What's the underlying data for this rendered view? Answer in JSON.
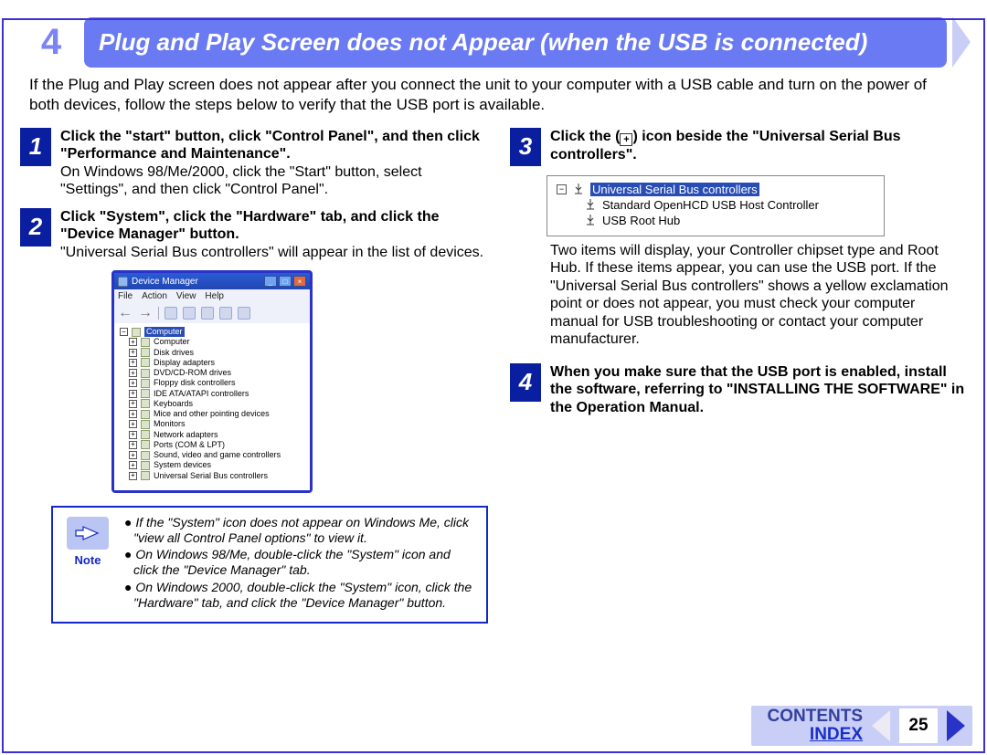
{
  "header": {
    "number": "4",
    "title": "Plug and Play Screen does not Appear (when the USB is connected)"
  },
  "intro": "If the Plug and Play screen does not appear after you connect the unit to your computer with a USB cable and turn on the power of both devices, follow the steps below to verify that the USB port is available.",
  "steps": {
    "s1": {
      "num": "1",
      "title": "Click the \"start\" button, click \"Control Panel\", and then click \"Performance and Maintenance\".",
      "body": "On Windows 98/Me/2000, click the \"Start\" button, select \"Settings\", and then click \"Control Panel\"."
    },
    "s2": {
      "num": "2",
      "title": "Click \"System\", click the \"Hardware\" tab, and click the \"Device Manager\" button.",
      "body": "\"Universal Serial Bus controllers\" will appear in the list of devices."
    },
    "s3": {
      "num": "3",
      "title_pre": "Click the (",
      "title_post": ") icon beside the \"Universal Serial Bus controllers\".",
      "body": "Two items will display, your Controller chipset type and Root Hub. If these items appear, you can use the USB port. If the \"Universal Serial Bus controllers\" shows a yellow exclamation point or does not appear, you must check your computer manual for USB troubleshooting or contact your computer manufacturer."
    },
    "s4": {
      "num": "4",
      "title": "When you make sure that the USB port is enabled, install the software, referring to \"INSTALLING THE SOFTWARE\" in the Operation Manual."
    }
  },
  "device_manager": {
    "title": "Device Manager",
    "menus": [
      "File",
      "Action",
      "View",
      "Help"
    ],
    "root": "Computer",
    "items": [
      "Computer",
      "Disk drives",
      "Display adapters",
      "DVD/CD-ROM drives",
      "Floppy disk controllers",
      "IDE ATA/ATAPI controllers",
      "Keyboards",
      "Mice and other pointing devices",
      "Monitors",
      "Network adapters",
      "Ports (COM & LPT)",
      "Sound, video and game controllers",
      "System devices",
      "Universal Serial Bus controllers"
    ]
  },
  "usb_snippet": {
    "root": "Universal Serial Bus controllers",
    "child1": "Standard OpenHCD USB Host Controller",
    "child2": "USB Root Hub"
  },
  "note": {
    "label": "Note",
    "items": [
      "If the \"System\" icon does not appear on Windows Me, click \"view all Control Panel options\" to view it.",
      "On Windows 98/Me, double-click the \"System\" icon and click the \"Device Manager\" tab.",
      "On Windows 2000, double-click the \"System\" icon, click the \"Hardware\" tab, and click the \"Device Manager\" button."
    ]
  },
  "footer": {
    "contents": "CONTENTS",
    "index": "INDEX",
    "page": "25"
  }
}
